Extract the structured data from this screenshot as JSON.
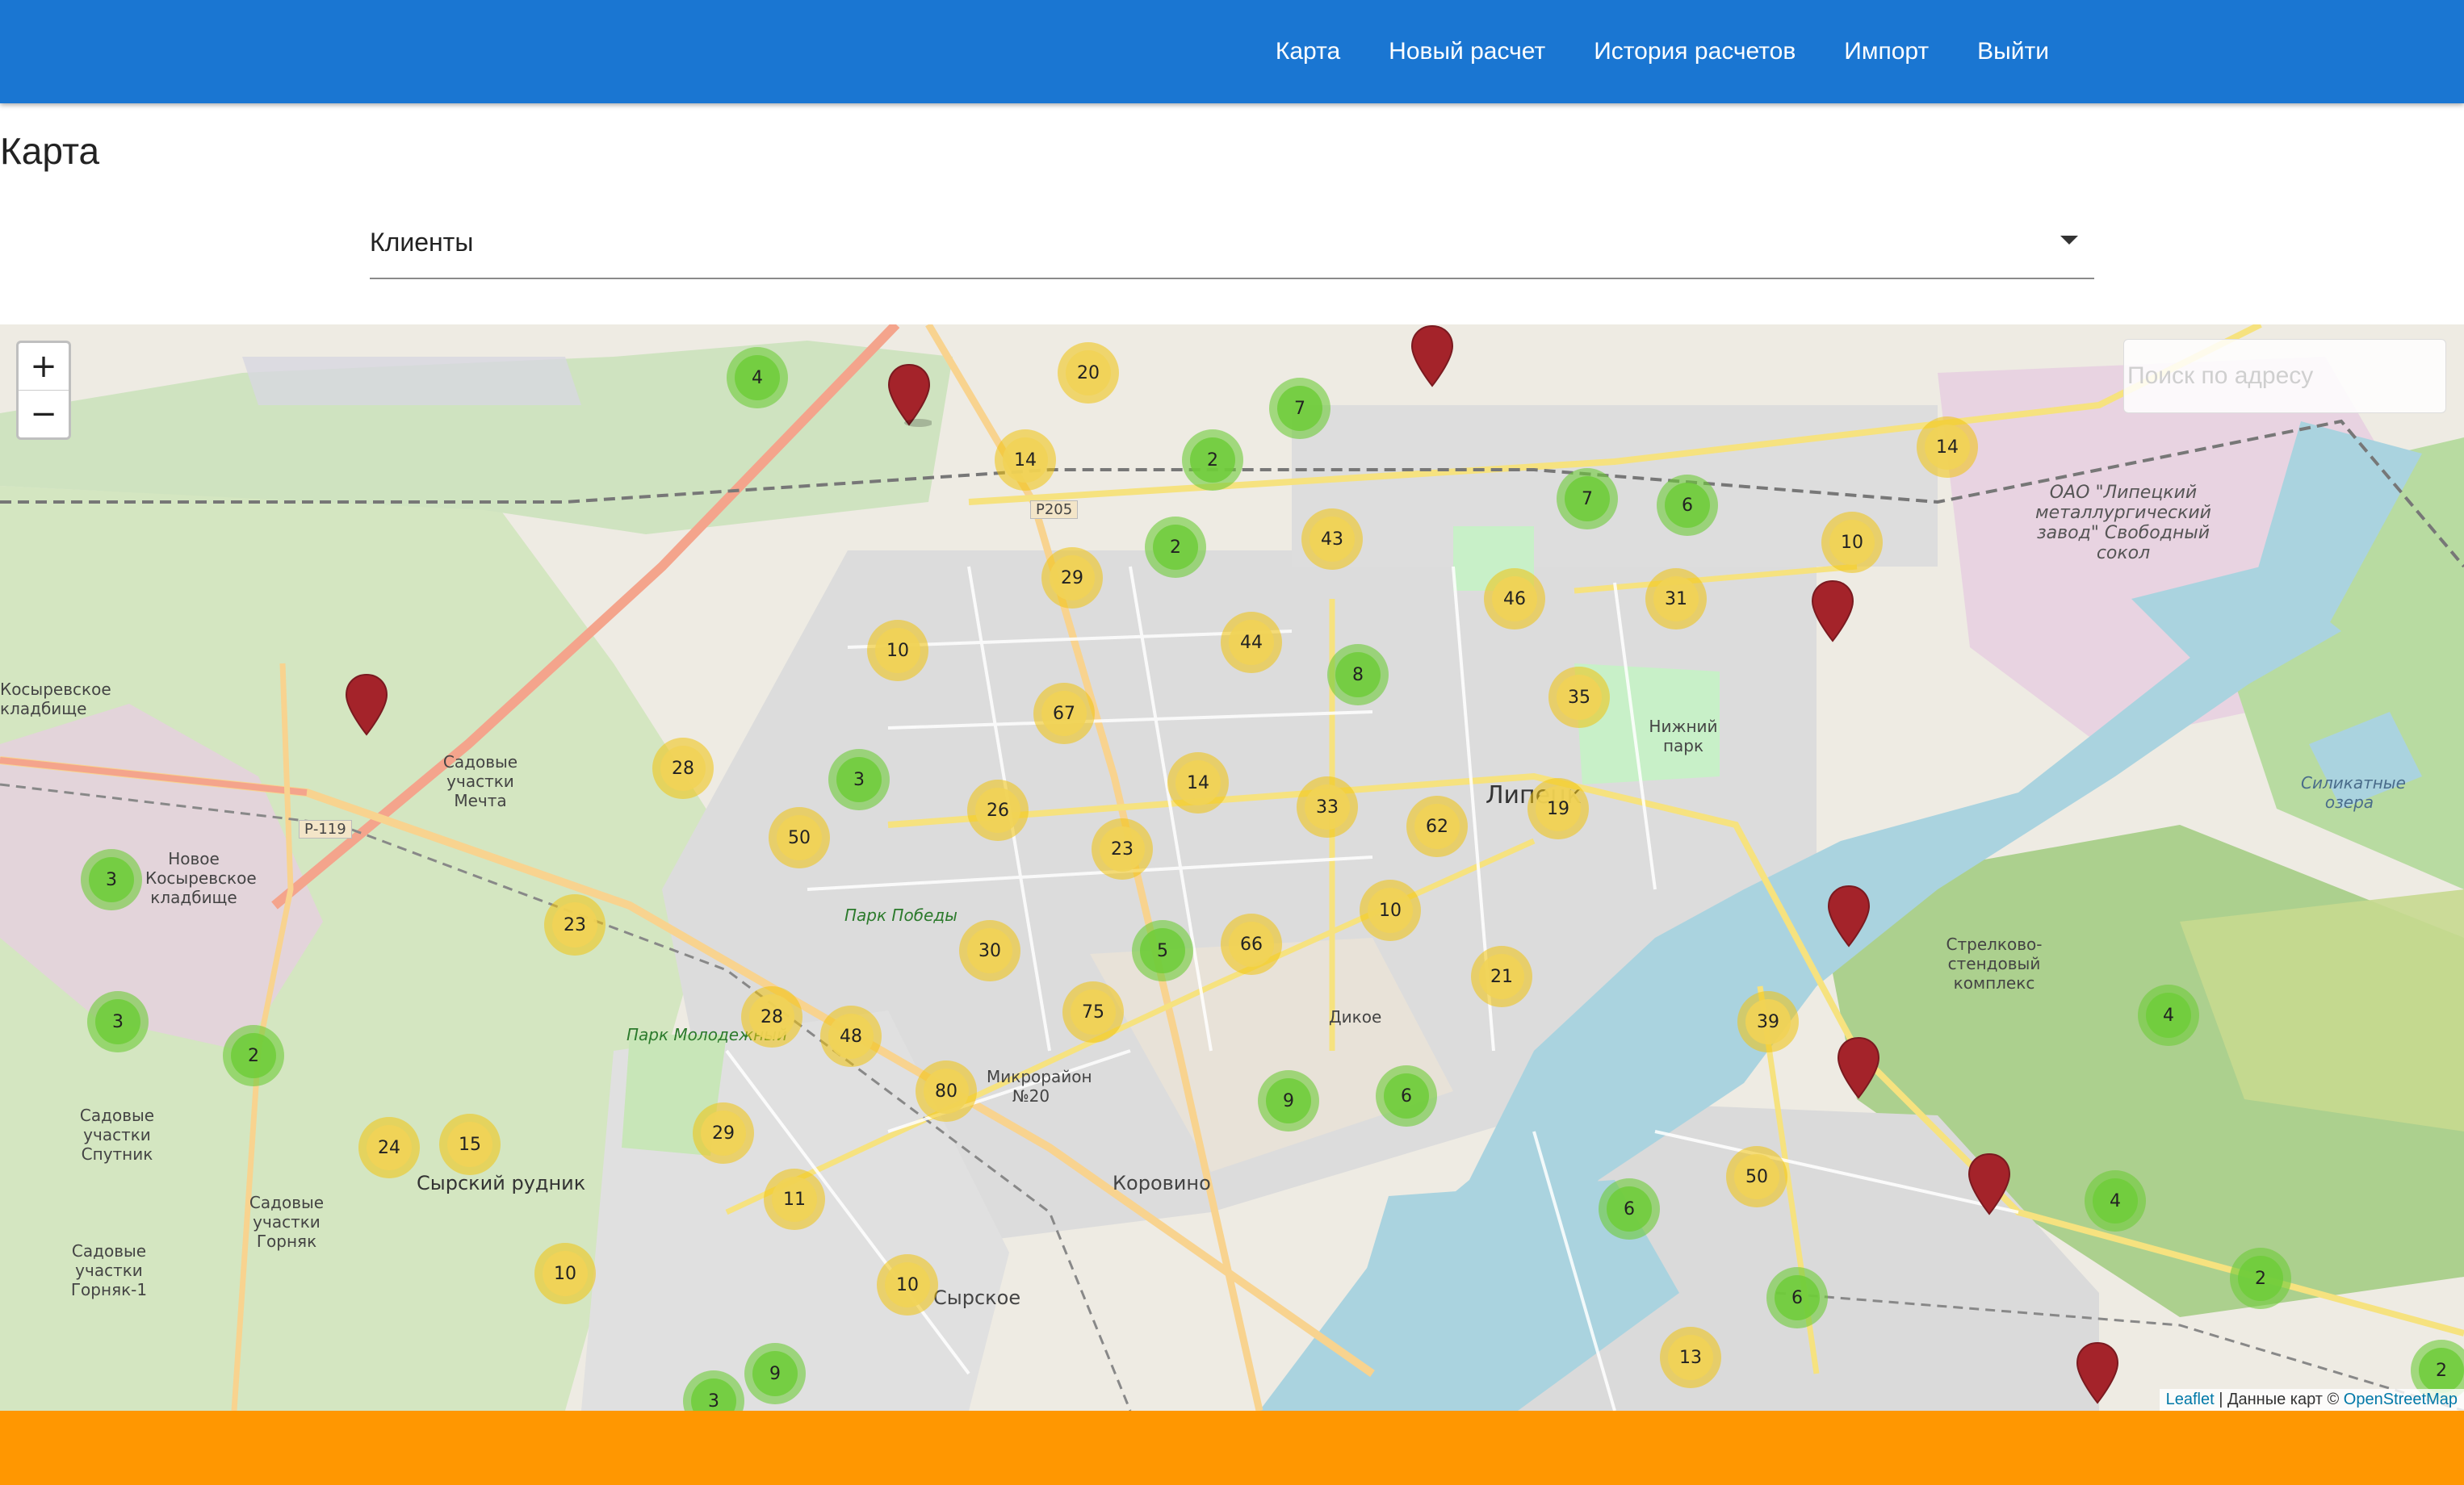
{
  "nav": {
    "items": [
      "Карта",
      "Новый расчет",
      "История расчетов",
      "Импорт",
      "Выйти"
    ]
  },
  "page": {
    "title": "Карта"
  },
  "filter": {
    "selected": "Клиенты"
  },
  "map": {
    "zoom_in": "+",
    "zoom_out": "−",
    "search_placeholder": "Поиск по адресу",
    "attribution": {
      "leaflet": "Leaflet",
      "separator": " | ",
      "data_text": "Данные карт © ",
      "osm": "OpenStreetMap"
    },
    "labels": [
      "ОАО \"Липецкий металлургический завод\" Свободный сокол",
      "Косыревское кладбище",
      "Садовые участки Мечта",
      "Новое Косыревское кладбище",
      "Сырский рудник",
      "Парк Победы",
      "Нижний парк",
      "Микрорайон №20",
      "Коровино",
      "Сырское",
      "Стрелково-стендовый комплекс",
      "Силикатные озера",
      "Парк Молодежный",
      "Садовые участки Спутник",
      "Садовые участки Горняк",
      "Садовые участки Горняк-1",
      "Р205",
      "Р-119",
      "Дикое",
      "Липецк"
    ],
    "clusters": [
      {
        "count": "4",
        "kind": "small"
      },
      {
        "count": "20",
        "kind": "medium"
      },
      {
        "count": "7",
        "kind": "small"
      },
      {
        "count": "14",
        "kind": "medium"
      },
      {
        "count": "2",
        "kind": "small"
      },
      {
        "count": "7",
        "kind": "small"
      },
      {
        "count": "6",
        "kind": "small"
      },
      {
        "count": "14",
        "kind": "medium"
      },
      {
        "count": "10",
        "kind": "medium"
      },
      {
        "count": "2",
        "kind": "small"
      },
      {
        "count": "43",
        "kind": "medium"
      },
      {
        "count": "29",
        "kind": "medium"
      },
      {
        "count": "46",
        "kind": "medium"
      },
      {
        "count": "31",
        "kind": "medium"
      },
      {
        "count": "10",
        "kind": "medium"
      },
      {
        "count": "44",
        "kind": "medium"
      },
      {
        "count": "8",
        "kind": "small"
      },
      {
        "count": "35",
        "kind": "medium"
      },
      {
        "count": "67",
        "kind": "medium"
      },
      {
        "count": "28",
        "kind": "medium"
      },
      {
        "count": "3",
        "kind": "small"
      },
      {
        "count": "14",
        "kind": "medium"
      },
      {
        "count": "26",
        "kind": "medium"
      },
      {
        "count": "33",
        "kind": "medium"
      },
      {
        "count": "62",
        "kind": "medium"
      },
      {
        "count": "19",
        "kind": "medium"
      },
      {
        "count": "50",
        "kind": "medium"
      },
      {
        "count": "23",
        "kind": "medium"
      },
      {
        "count": "3",
        "kind": "small"
      },
      {
        "count": "10",
        "kind": "medium"
      },
      {
        "count": "23",
        "kind": "medium"
      },
      {
        "count": "5",
        "kind": "small"
      },
      {
        "count": "66",
        "kind": "medium"
      },
      {
        "count": "30",
        "kind": "medium"
      },
      {
        "count": "21",
        "kind": "medium"
      },
      {
        "count": "3",
        "kind": "small"
      },
      {
        "count": "2",
        "kind": "small"
      },
      {
        "count": "28",
        "kind": "medium"
      },
      {
        "count": "48",
        "kind": "medium"
      },
      {
        "count": "75",
        "kind": "medium"
      },
      {
        "count": "39",
        "kind": "medium"
      },
      {
        "count": "4",
        "kind": "small"
      },
      {
        "count": "80",
        "kind": "medium"
      },
      {
        "count": "9",
        "kind": "small"
      },
      {
        "count": "6",
        "kind": "small"
      },
      {
        "count": "24",
        "kind": "medium"
      },
      {
        "count": "15",
        "kind": "medium"
      },
      {
        "count": "29",
        "kind": "medium"
      },
      {
        "count": "11",
        "kind": "medium"
      },
      {
        "count": "50",
        "kind": "medium"
      },
      {
        "count": "6",
        "kind": "small"
      },
      {
        "count": "4",
        "kind": "small"
      },
      {
        "count": "10",
        "kind": "medium"
      },
      {
        "count": "10",
        "kind": "medium"
      },
      {
        "count": "6",
        "kind": "small"
      },
      {
        "count": "2",
        "kind": "small"
      },
      {
        "count": "9",
        "kind": "small"
      },
      {
        "count": "13",
        "kind": "medium"
      },
      {
        "count": "3",
        "kind": "small"
      },
      {
        "count": "2",
        "kind": "small"
      }
    ]
  }
}
